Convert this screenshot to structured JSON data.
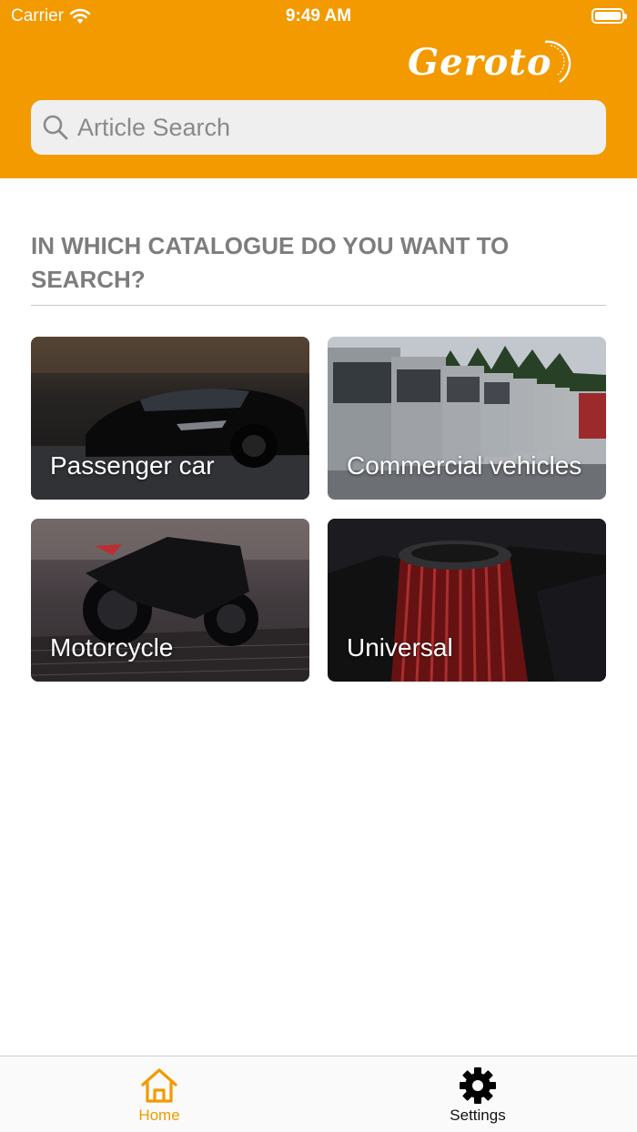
{
  "status_bar": {
    "carrier": "Carrier",
    "time": "9:49 AM",
    "wifi_icon": "wifi-icon",
    "battery_icon": "battery-icon"
  },
  "header": {
    "logo_text": "Geroto",
    "background_color": "#f39a00"
  },
  "search": {
    "placeholder": "Article Search",
    "value": "",
    "icon": "search-icon"
  },
  "section": {
    "title": "IN WHICH CATALOGUE DO YOU WANT TO SEARCH?"
  },
  "catalogues": [
    {
      "label": "Passenger car"
    },
    {
      "label": "Commercial vehicles"
    },
    {
      "label": "Motorcycle"
    },
    {
      "label": "Universal"
    }
  ],
  "tab_bar": {
    "accent_color": "#f39a00",
    "tabs": [
      {
        "label": "Home",
        "icon": "home-icon",
        "active": true
      },
      {
        "label": "Settings",
        "icon": "gear-icon",
        "active": false
      }
    ]
  }
}
